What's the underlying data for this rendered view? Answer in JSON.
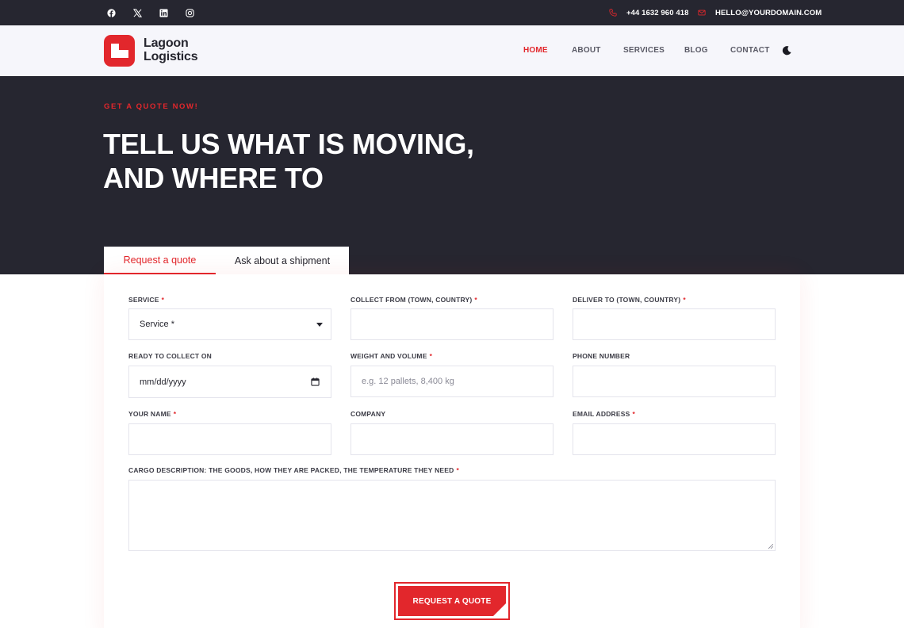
{
  "topbar": {
    "social": [
      "facebook-icon",
      "x-icon",
      "linkedin-icon",
      "instagram-icon"
    ],
    "phone": "+44 1632 960 418",
    "email": "HELLO@YOURDOMAIN.COM"
  },
  "header": {
    "brand_line1": "Lagoon",
    "brand_line2": "Logistics",
    "nav": [
      "HOME",
      "ABOUT",
      "SERVICES",
      "BLOG",
      "CONTACT"
    ],
    "active_nav": "HOME"
  },
  "hero": {
    "eyebrow": "GET A QUOTE NOW!",
    "title_line1": "TELL US WHAT IS MOVING,",
    "title_line2": "AND WHERE TO"
  },
  "tabs": [
    "Request a quote",
    "Ask about a shipment"
  ],
  "form": {
    "service_label": "SERVICE",
    "service_value": "Service *",
    "collect_label": "COLLECT FROM (TOWN, COUNTRY)",
    "deliver_label": "DELIVER TO (TOWN, COUNTRY)",
    "ready_label": "READY TO COLLECT ON",
    "ready_value": "mm/dd/yyyy",
    "weight_label": "WEIGHT AND VOLUME",
    "weight_placeholder": "e.g. 12 pallets, 8,400 kg",
    "phone_label": "PHONE NUMBER",
    "name_label": "YOUR NAME",
    "company_label": "COMPANY",
    "email_label": "EMAIL ADDRESS",
    "cargo_label": "CARGO DESCRIPTION: THE GOODS, HOW THEY ARE PACKED, THE TEMPERATURE THEY NEED",
    "required_mark": "*",
    "submit_label": "REQUEST A QUOTE"
  },
  "colors": {
    "accent": "#e2272c",
    "dark": "#262630",
    "header_bg": "#f6f6fb"
  }
}
